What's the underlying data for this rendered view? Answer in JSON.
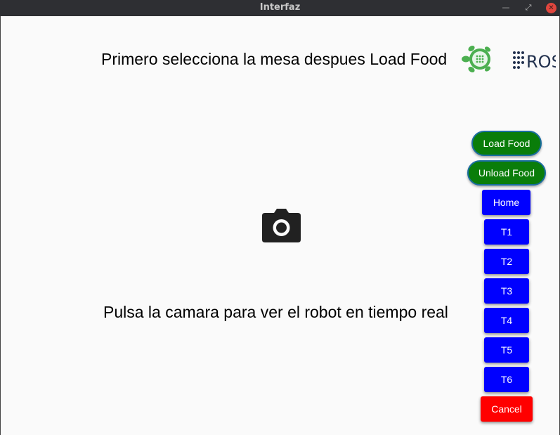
{
  "window": {
    "title": "Interfaz"
  },
  "main": {
    "instruction": "Primero selecciona la mesa despues Load Food",
    "camera_hint": "Pulsa la camara para ver el robot en tiempo real",
    "ros_logo_text": "ROS"
  },
  "buttons": {
    "load_food": "Load Food",
    "unload_food": "Unload Food",
    "home": "Home",
    "t1": "T1",
    "t2": "T2",
    "t3": "T3",
    "t4": "T4",
    "t5": "T5",
    "t6": "T6",
    "cancel": "Cancel"
  },
  "colors": {
    "green_button": "#0a7d0a",
    "blue_button": "#0000ff",
    "red_button": "#ff0000",
    "turtle": "#4caf50"
  }
}
